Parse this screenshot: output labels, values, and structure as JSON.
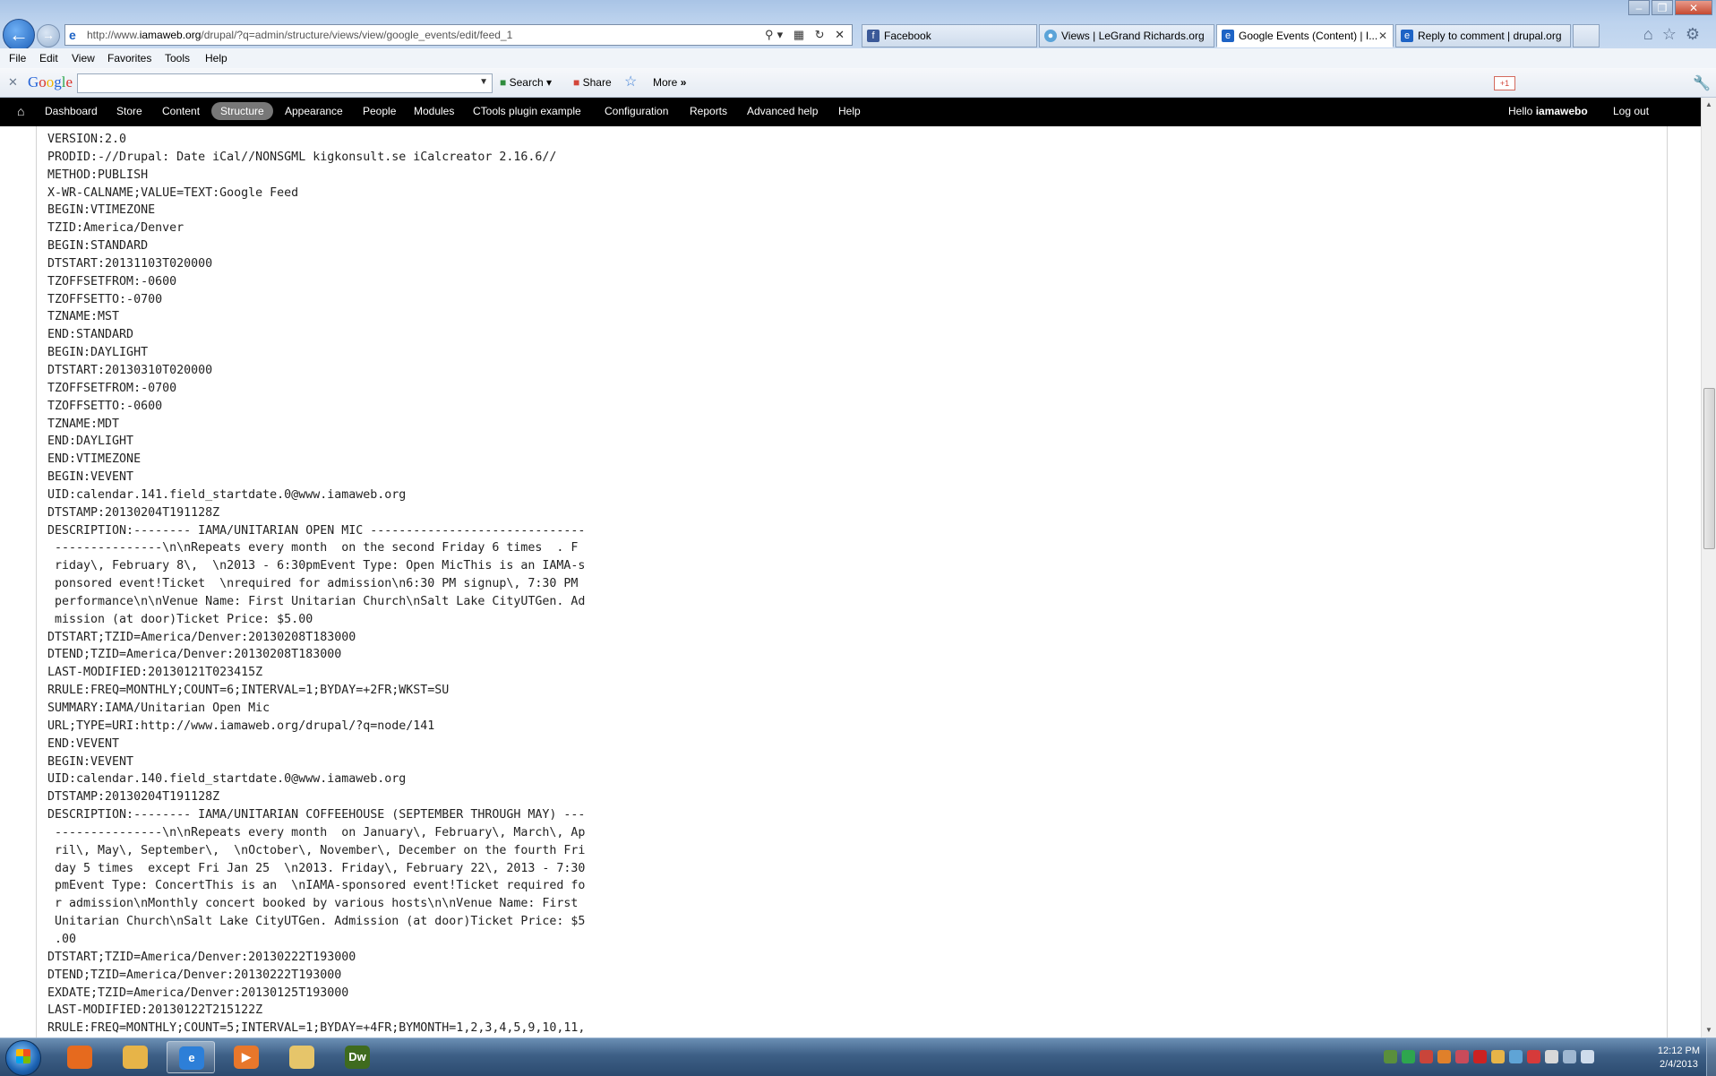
{
  "browser": {
    "address": {
      "url_prefix": "http://www.",
      "url_domain": "iamaweb.org",
      "url_path": "/drupal/?q=admin/structure/views/view/google_events/edit/feed_1"
    },
    "tabs": [
      {
        "label": "Facebook",
        "icon": "facebook-icon",
        "color": "#3b5998"
      },
      {
        "label": "Views | LeGrand Richards.org",
        "icon": "globe-icon",
        "color": "#5aa3d8"
      },
      {
        "label": "Google Events (Content) | I...",
        "icon": "ie-icon",
        "color": "#1d63c5"
      },
      {
        "label": "Reply to comment | drupal.org",
        "icon": "drupal-icon",
        "color": "#1d63c5"
      }
    ],
    "menu": [
      "File",
      "Edit",
      "View",
      "Favorites",
      "Tools",
      "Help"
    ],
    "google_toolbar": {
      "logo": "Google",
      "search_label": "Search",
      "share_label": "Share",
      "more_label": "More",
      "gplus_label": "+1"
    }
  },
  "admin_bar": {
    "items": [
      "Dashboard",
      "Store",
      "Content",
      "Structure",
      "Appearance",
      "People",
      "Modules",
      "CTools plugin example",
      "Configuration",
      "Reports",
      "Advanced help",
      "Help"
    ],
    "active": "Structure",
    "greeting": "Hello ",
    "username": "iamawebo",
    "logout": "Log out"
  },
  "ical_lines": [
    "VERSION:2.0",
    "PRODID:-//Drupal: Date iCal//NONSGML kigkonsult.se iCalcreator 2.16.6//",
    "METHOD:PUBLISH",
    "X-WR-CALNAME;VALUE=TEXT:Google Feed",
    "BEGIN:VTIMEZONE",
    "TZID:America/Denver",
    "BEGIN:STANDARD",
    "DTSTART:20131103T020000",
    "TZOFFSETFROM:-0600",
    "TZOFFSETTO:-0700",
    "TZNAME:MST",
    "END:STANDARD",
    "BEGIN:DAYLIGHT",
    "DTSTART:20130310T020000",
    "TZOFFSETFROM:-0700",
    "TZOFFSETTO:-0600",
    "TZNAME:MDT",
    "END:DAYLIGHT",
    "END:VTIMEZONE",
    "BEGIN:VEVENT",
    "UID:calendar.141.field_startdate.0@www.iamaweb.org",
    "DTSTAMP:20130204T191128Z",
    "DESCRIPTION:-------- IAMA/UNITARIAN OPEN MIC ------------------------------",
    " ---------------\\n\\nRepeats every month  on the second Friday 6 times  . F",
    " riday\\, February 8\\,  \\n2013 - 6:30pmEvent Type: Open MicThis is an IAMA-s",
    " ponsored event!Ticket  \\nrequired for admission\\n6:30 PM signup\\, 7:30 PM",
    " performance\\n\\nVenue Name: First Unitarian Church\\nSalt Lake CityUTGen. Ad",
    " mission (at door)Ticket Price: $5.00",
    "DTSTART;TZID=America/Denver:20130208T183000",
    "DTEND;TZID=America/Denver:20130208T183000",
    "LAST-MODIFIED:20130121T023415Z",
    "RRULE:FREQ=MONTHLY;COUNT=6;INTERVAL=1;BYDAY=+2FR;WKST=SU",
    "SUMMARY:IAMA/Unitarian Open Mic",
    "URL;TYPE=URI:http://www.iamaweb.org/drupal/?q=node/141",
    "END:VEVENT",
    "BEGIN:VEVENT",
    "UID:calendar.140.field_startdate.0@www.iamaweb.org",
    "DTSTAMP:20130204T191128Z",
    "DESCRIPTION:-------- IAMA/UNITARIAN COFFEEHOUSE (SEPTEMBER THROUGH MAY) ---",
    " ---------------\\n\\nRepeats every month  on January\\, February\\, March\\, Ap",
    " ril\\, May\\, September\\,  \\nOctober\\, November\\, December on the fourth Fri",
    " day 5 times  except Fri Jan 25  \\n2013. Friday\\, February 22\\, 2013 - 7:30",
    " pmEvent Type: ConcertThis is an  \\nIAMA-sponsored event!Ticket required fo",
    " r admission\\nMonthly concert booked by various hosts\\n\\nVenue Name: First",
    " Unitarian Church\\nSalt Lake CityUTGen. Admission (at door)Ticket Price: $5",
    " .00",
    "DTSTART;TZID=America/Denver:20130222T193000",
    "DTEND;TZID=America/Denver:20130222T193000",
    "EXDATE;TZID=America/Denver:20130125T193000",
    "LAST-MODIFIED:20130122T215122Z",
    "RRULE:FREQ=MONTHLY;COUNT=5;INTERVAL=1;BYDAY=+4FR;BYMONTH=1,2,3,4,5,9,10,11,"
  ],
  "taskbar": {
    "apps": [
      {
        "name": "firefox",
        "glyph": "",
        "color": "#e66a1e"
      },
      {
        "name": "outlook",
        "glyph": "",
        "color": "#e7b448"
      },
      {
        "name": "internet-explorer",
        "glyph": "e",
        "color": "#2d7fd8"
      },
      {
        "name": "media-player",
        "glyph": "▶",
        "color": "#e8772b"
      },
      {
        "name": "file-explorer",
        "glyph": "",
        "color": "#e6c56a"
      },
      {
        "name": "dreamweaver",
        "glyph": "Dw",
        "color": "#3f6b1e"
      }
    ],
    "clock_time": "12:12 PM",
    "clock_date": "2/4/2013"
  }
}
